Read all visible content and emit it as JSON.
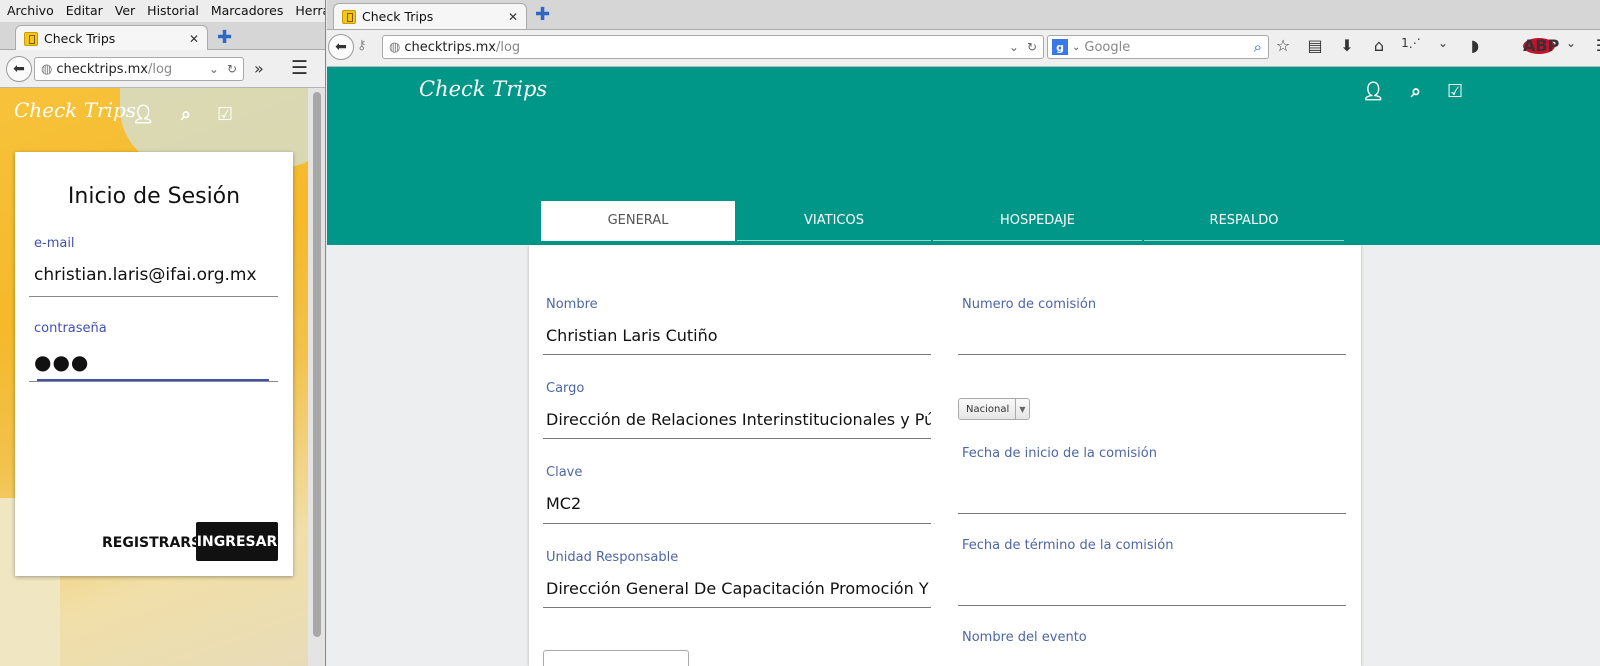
{
  "left": {
    "menu": [
      "Archivo",
      "Editar",
      "Ver",
      "Historial",
      "Marcadores",
      "Herramie"
    ],
    "tab_title": "Check Trips",
    "url_host": "checktrips.mx",
    "url_path": "/log",
    "logo": "Check Trips",
    "login": {
      "title": "Inicio de Sesión",
      "email_label": "e-mail",
      "email_value": "christian.laris@ifai.org.mx",
      "password_label": "contraseña",
      "password_value": "●●●",
      "register_label": "REGISTRARSE",
      "login_label": "INGRESAR"
    }
  },
  "right": {
    "tab_title": "Check Trips",
    "url_host": "checktrips.mx",
    "url_path": "/log",
    "search_placeholder": "Google",
    "logo": "Check Trips",
    "tabs": [
      "GENERAL",
      "VIATICOS",
      "HOSPEDAJE",
      "RESPALDO"
    ],
    "form": {
      "nombre_label": "Nombre",
      "nombre_value": "Christian Laris Cutiño",
      "cargo_label": "Cargo",
      "cargo_value": "Dirección de Relaciones Interinstitucionales y Púb",
      "clave_label": "Clave",
      "clave_value": "MC2",
      "unidad_label": "Unidad Responsable",
      "unidad_value": "Dirección General De Capacitación  Promoción Y F",
      "numero_label": "Numero de comisión",
      "tipo_value": "Nacional",
      "fecha_inicio_label": "Fecha de inicio de la comisión",
      "fecha_termino_label": "Fecha de término de la comisión",
      "evento_label": "Nombre del evento"
    }
  }
}
